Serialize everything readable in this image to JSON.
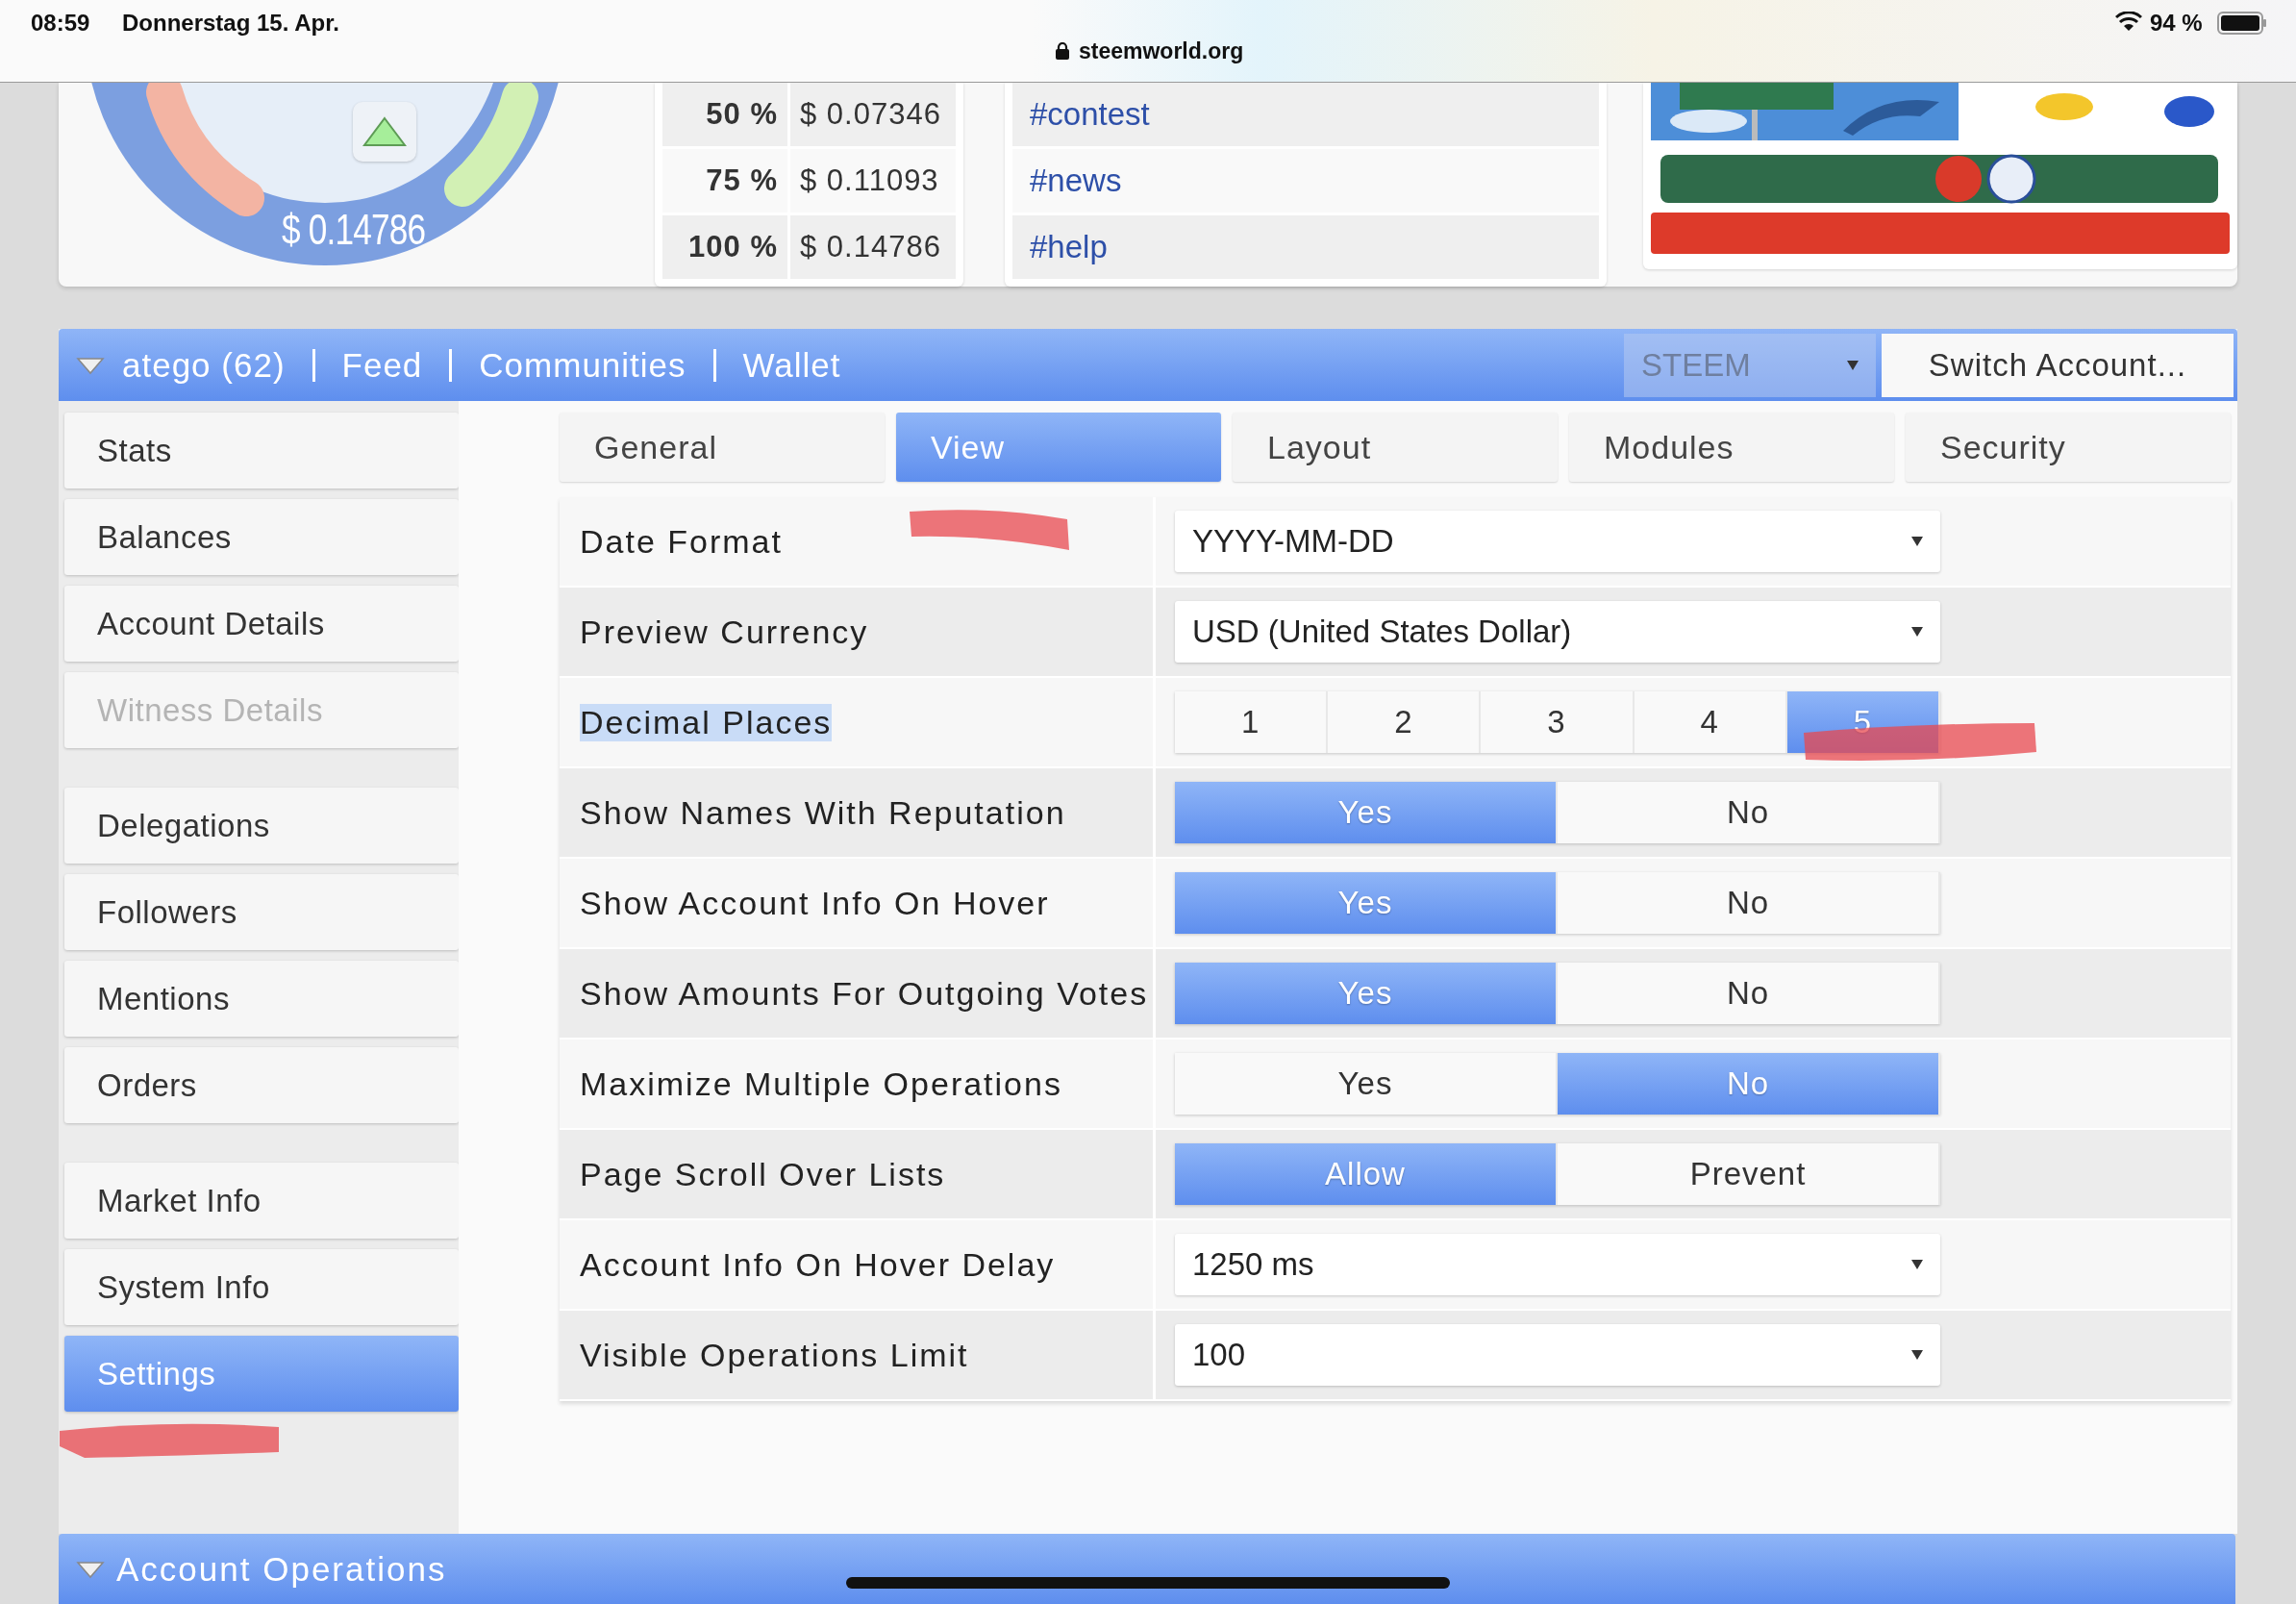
{
  "status_bar": {
    "time": "08:59",
    "date": "Donnerstag 15. Apr.",
    "url": "steemworld.org",
    "battery": "94 %"
  },
  "top_card": {
    "gauge_value": "$ 0.14786",
    "vote_table": [
      {
        "percent": "50 %",
        "value": "$ 0.07346"
      },
      {
        "percent": "75 %",
        "value": "$ 0.11093"
      },
      {
        "percent": "100 %",
        "value": "$ 0.14786"
      }
    ],
    "tags": [
      "#contest",
      "#news",
      "#help"
    ],
    "banner": {
      "kind": "picture"
    }
  },
  "nav": {
    "account": "atego (62)",
    "links": [
      "Feed",
      "Communities",
      "Wallet"
    ],
    "chain_select": "STEEM",
    "switch_button": "Switch Account..."
  },
  "sidebar": {
    "groups": [
      [
        {
          "label": "Stats",
          "selected": false,
          "disabled": false
        },
        {
          "label": "Balances",
          "selected": false,
          "disabled": false
        },
        {
          "label": "Account Details",
          "selected": false,
          "disabled": false
        },
        {
          "label": "Witness Details",
          "selected": false,
          "disabled": true
        }
      ],
      [
        {
          "label": "Delegations",
          "selected": false,
          "disabled": false
        },
        {
          "label": "Followers",
          "selected": false,
          "disabled": false
        },
        {
          "label": "Mentions",
          "selected": false,
          "disabled": false
        },
        {
          "label": "Orders",
          "selected": false,
          "disabled": false
        }
      ],
      [
        {
          "label": "Market Info",
          "selected": false,
          "disabled": false
        },
        {
          "label": "System Info",
          "selected": false,
          "disabled": false
        },
        {
          "label": "Settings",
          "selected": true,
          "disabled": false
        }
      ]
    ]
  },
  "tabs": [
    {
      "label": "General",
      "selected": false
    },
    {
      "label": "View",
      "selected": true
    },
    {
      "label": "Layout",
      "selected": false
    },
    {
      "label": "Modules",
      "selected": false
    },
    {
      "label": "Security",
      "selected": false
    }
  ],
  "settings": [
    {
      "label": "Date Format",
      "highlighted": false,
      "kind": "select",
      "value": "YYYY-MM-DD"
    },
    {
      "label": "Preview Currency",
      "highlighted": false,
      "kind": "select",
      "value": "USD (United States Dollar)"
    },
    {
      "label": "Decimal Places",
      "highlighted": true,
      "kind": "segmented",
      "options": [
        {
          "label": "1",
          "selected": false
        },
        {
          "label": "2",
          "selected": false
        },
        {
          "label": "3",
          "selected": false
        },
        {
          "label": "4",
          "selected": false
        },
        {
          "label": "5",
          "selected": true
        }
      ]
    },
    {
      "label": "Show Names With Reputation",
      "highlighted": false,
      "kind": "segmented",
      "options": [
        {
          "label": "Yes",
          "selected": true
        },
        {
          "label": "No",
          "selected": false
        }
      ]
    },
    {
      "label": "Show Account Info On Hover",
      "highlighted": false,
      "kind": "segmented",
      "options": [
        {
          "label": "Yes",
          "selected": true
        },
        {
          "label": "No",
          "selected": false
        }
      ]
    },
    {
      "label": "Show Amounts For Outgoing Votes",
      "highlighted": false,
      "kind": "segmented",
      "options": [
        {
          "label": "Yes",
          "selected": true
        },
        {
          "label": "No",
          "selected": false
        }
      ]
    },
    {
      "label": "Maximize Multiple Operations",
      "highlighted": false,
      "kind": "segmented",
      "options": [
        {
          "label": "Yes",
          "selected": false
        },
        {
          "label": "No",
          "selected": true
        }
      ]
    },
    {
      "label": "Page Scroll Over Lists",
      "highlighted": false,
      "kind": "segmented",
      "options": [
        {
          "label": "Allow",
          "selected": true
        },
        {
          "label": "Prevent",
          "selected": false
        }
      ]
    },
    {
      "label": "Account Info On Hover Delay",
      "highlighted": false,
      "kind": "select",
      "value": "1250 ms"
    },
    {
      "label": "Visible Operations Limit",
      "highlighted": false,
      "kind": "select",
      "value": "100"
    }
  ],
  "bottom_bar": {
    "title": "Account Operations"
  }
}
